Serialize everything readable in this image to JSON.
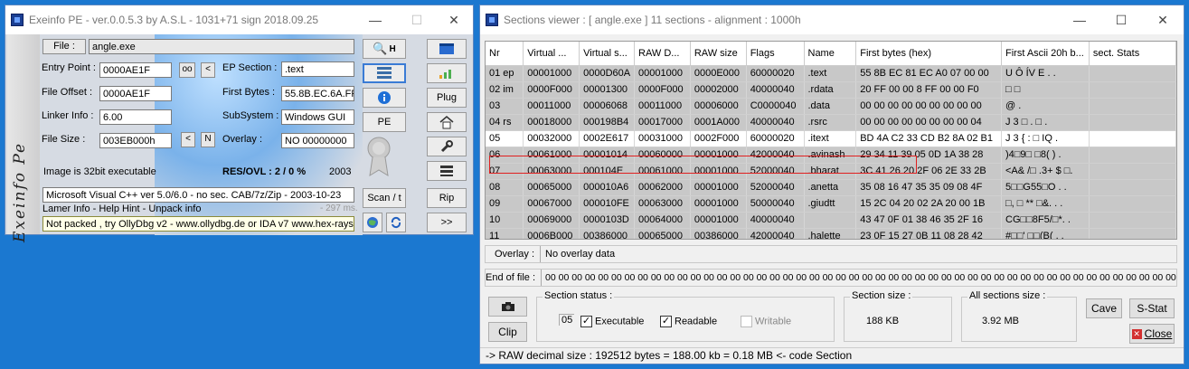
{
  "exe": {
    "title": "Exeinfo PE - ver.0.0.5.3  by A.S.L -  1031+71 sign  2018.09.25",
    "side_text": "Exeinfo Pe",
    "file_btn": "File :",
    "file_name": "angle.exe",
    "entry_point_label": "Entry Point :",
    "entry_point": "0000AE1F",
    "oo_btn": "oo",
    "lt_btn": "<",
    "ep_section_label": "EP Section :",
    "ep_section": ".text",
    "file_offset_label": "File Offset :",
    "file_offset": "0000AE1F",
    "first_bytes_label": "First Bytes :",
    "first_bytes": "55.8B.EC.6A.FF",
    "linker_label": "Linker Info :",
    "linker": "6.00",
    "subsystem_label": "SubSystem :",
    "subsystem": "Windows GUI",
    "file_size_label": "File Size :",
    "file_size": "003EB000h",
    "n_btn": "N",
    "overlay_label": "Overlay :",
    "overlay": "NO  00000000",
    "bits_text": "Image is 32bit executable",
    "resovl": "RES/OVL : 2 / 0 %",
    "year": "2003",
    "detect": "Microsoft Visual C++ ver 5.0/6.0 - no sec. CAB/7z/Zip - 2003-10-23",
    "ms": "- 297 ms.",
    "lamer": "Lamer Info - Help Hint - Unpack info",
    "hint": "Not packed , try OllyDbg v2 - www.ollydbg.de or IDA v7 www.hex-rays.com",
    "btn_h": "H",
    "btn_pe": "PE",
    "btn_plug": "Plug",
    "btn_scan": "Scan / t",
    "btn_rip": "Rip",
    "btn_next": ">>"
  },
  "sec": {
    "title": "Sections viewer :  [ angle.exe ] 11 sections - alignment : 1000h",
    "columns": [
      "Nr",
      "Virtual ...",
      "Virtual s...",
      "RAW D...",
      "RAW size",
      "Flags",
      "Name",
      "First bytes (hex)",
      "First Ascii 20h b...",
      "sect. Stats"
    ],
    "rows": [
      [
        "01 ep",
        "00001000",
        "0000D60A",
        "00001000",
        "0000E000",
        "60000020",
        ".text",
        "55 8B EC 81 EC A0 07 00 00",
        "U    Ô   ÍV E        .   .",
        ""
      ],
      [
        "02 im",
        "0000F000",
        "00001300",
        "0000F000",
        "00002000",
        "40000040",
        ".rdata",
        "20 FF 00 00 8 FF 00 00 F0",
        "     □              □",
        ""
      ],
      [
        "03",
        "00011000",
        "00006068",
        "00011000",
        "00006000",
        "C0000040",
        ".data",
        "00 00 00 00 00 00 00 00 00",
        "                       @       .",
        ""
      ],
      [
        "04 rs",
        "00018000",
        "000198B4",
        "00017000",
        "0001A000",
        "40000040",
        ".rsrc",
        "00 00 00 00 00 00 00 00 04",
        "   J 3       □  .  □  .",
        ""
      ],
      [
        "05",
        "00032000",
        "0002E617",
        "00031000",
        "0002F000",
        "60000020",
        ".itext",
        "BD 4A C2 33 CD B2 8A 02 B1",
        "J 3      { : □ IQ   .",
        ""
      ],
      [
        "06",
        "00061000",
        "00001014",
        "00060000",
        "00001000",
        "42000040",
        ".avinash",
        "29 34 11 39 05 0D 1A 38 28",
        ")4□9□ □8( ) .",
        ""
      ],
      [
        "07",
        "00063000",
        "000104E",
        "00061000",
        "00001000",
        "52000040",
        ".bharat",
        "3C 41 26 20 2F 06 2E 33 2B",
        "<A& /□ .3+ $ □.",
        ""
      ],
      [
        "08",
        "00065000",
        "000010A6",
        "00062000",
        "00001000",
        "52000040",
        ".anetta",
        "35 08 16 47 35 35 09 08 4F",
        "5□□G55□O . .",
        ""
      ],
      [
        "09",
        "00067000",
        "000010FE",
        "00063000",
        "00001000",
        "50000040",
        ".giudtt",
        "15 2C 04 20 02 2A 20 00 1B",
        "□, □   ** □&. . .",
        ""
      ],
      [
        "10",
        "00069000",
        "0000103D",
        "00064000",
        "00001000",
        "40000040",
        "",
        "43 47 0F 01 38 46 35 2F 16",
        "CG□□8F5/□*.  .",
        ""
      ],
      [
        "11",
        "0006B000",
        "00386000",
        "00065000",
        "00386000",
        "42000040",
        ".halette",
        "23 0F 15 27 0B 11 08 28 42",
        "#□□' □□(B(  . .",
        ""
      ]
    ],
    "overlay_label": "Overlay :",
    "overlay": "No overlay data",
    "eof_label": "End of file :",
    "eof": "00 00 00 00 00 00 00 00 00 00 00 00 00 00 00 00 00 00 00 00 00 00 00 00 00 00 00 00 00 00 00 00 00 00 00 00 00 00 00 00 00 00 00 00 00 00 00 00 00 00 00 00 00 00 00 00 00 00 00",
    "status_title": "Section status :",
    "status_num": "05",
    "executable": "Executable",
    "readable": "Readable",
    "writable": "Writable",
    "size_title": "Section size :",
    "size_val": "188 KB",
    "all_title": "All sections size :",
    "all_val": "3.92 MB",
    "clip": "Clip",
    "cave": "Cave",
    "sstat": "S-Stat",
    "close": "Close",
    "statusbar": "->  RAW decimal size :     192512 bytes  =  188.00 kb  =  0.18 MB <- code Section"
  },
  "colors": {
    "accent": "#1b78d0",
    "highlight": "#e02020"
  }
}
